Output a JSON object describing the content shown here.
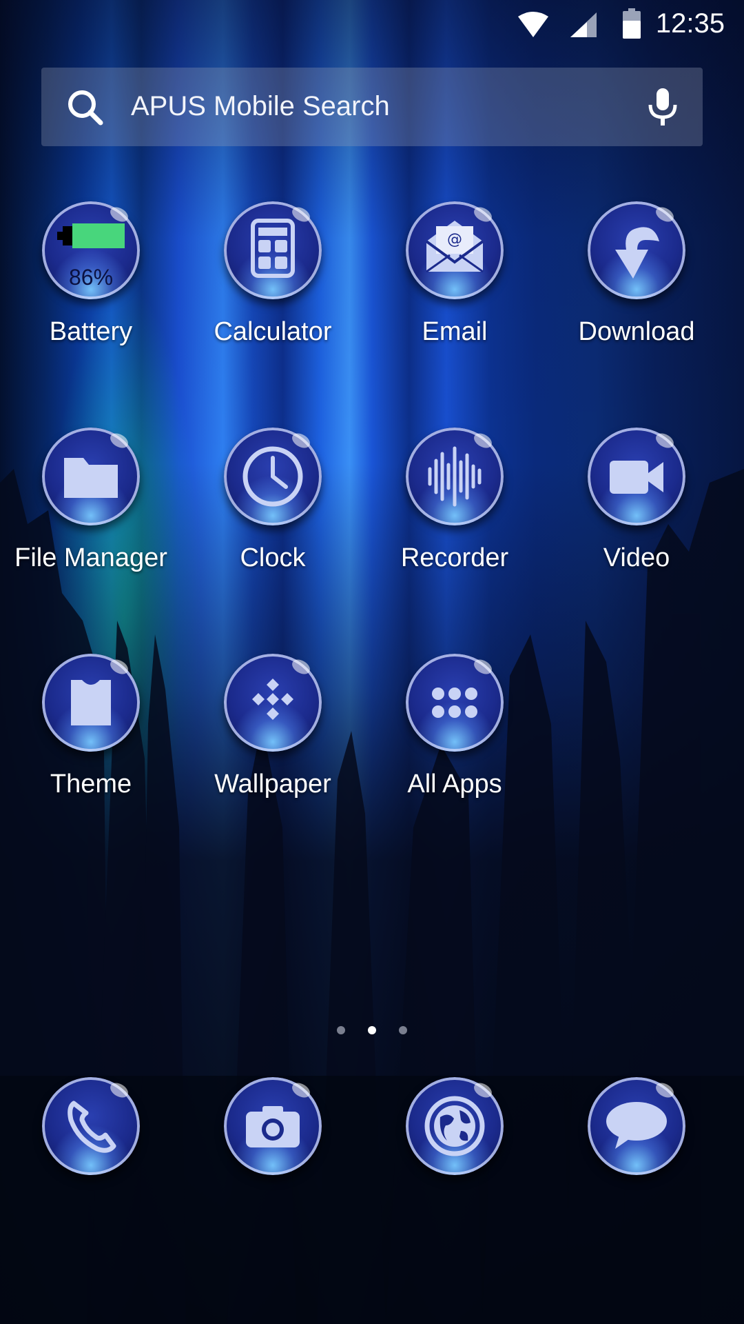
{
  "status_bar": {
    "time": "12:35",
    "icons": [
      "wifi-icon",
      "cellular-signal-icon",
      "battery-icon"
    ]
  },
  "search": {
    "placeholder": "APUS Mobile Search",
    "left_icon": "search-icon",
    "right_icon": "microphone-icon"
  },
  "apps": [
    {
      "label": "Battery",
      "icon": "battery-icon",
      "badge": "86%"
    },
    {
      "label": "Calculator",
      "icon": "calculator-icon"
    },
    {
      "label": "Email",
      "icon": "envelope-icon"
    },
    {
      "label": "Download",
      "icon": "download-arrow-icon"
    },
    {
      "label": "File Manager",
      "icon": "folder-icon"
    },
    {
      "label": "Clock",
      "icon": "clock-icon"
    },
    {
      "label": "Recorder",
      "icon": "sound-wave-icon"
    },
    {
      "label": "Video",
      "icon": "video-camera-icon"
    },
    {
      "label": "Theme",
      "icon": "shirt-icon"
    },
    {
      "label": "Wallpaper",
      "icon": "diamond-pattern-icon"
    },
    {
      "label": "All Apps",
      "icon": "app-grid-icon"
    }
  ],
  "page_indicator": {
    "pages": 3,
    "current": 2
  },
  "dock": [
    {
      "icon": "phone-icon"
    },
    {
      "icon": "camera-icon"
    },
    {
      "icon": "globe-browser-icon"
    },
    {
      "icon": "chat-bubble-icon"
    }
  ],
  "colors": {
    "orb": "#1b2a8c",
    "glyph": "#c9d3f5",
    "battery_fill": "#48d67c"
  }
}
